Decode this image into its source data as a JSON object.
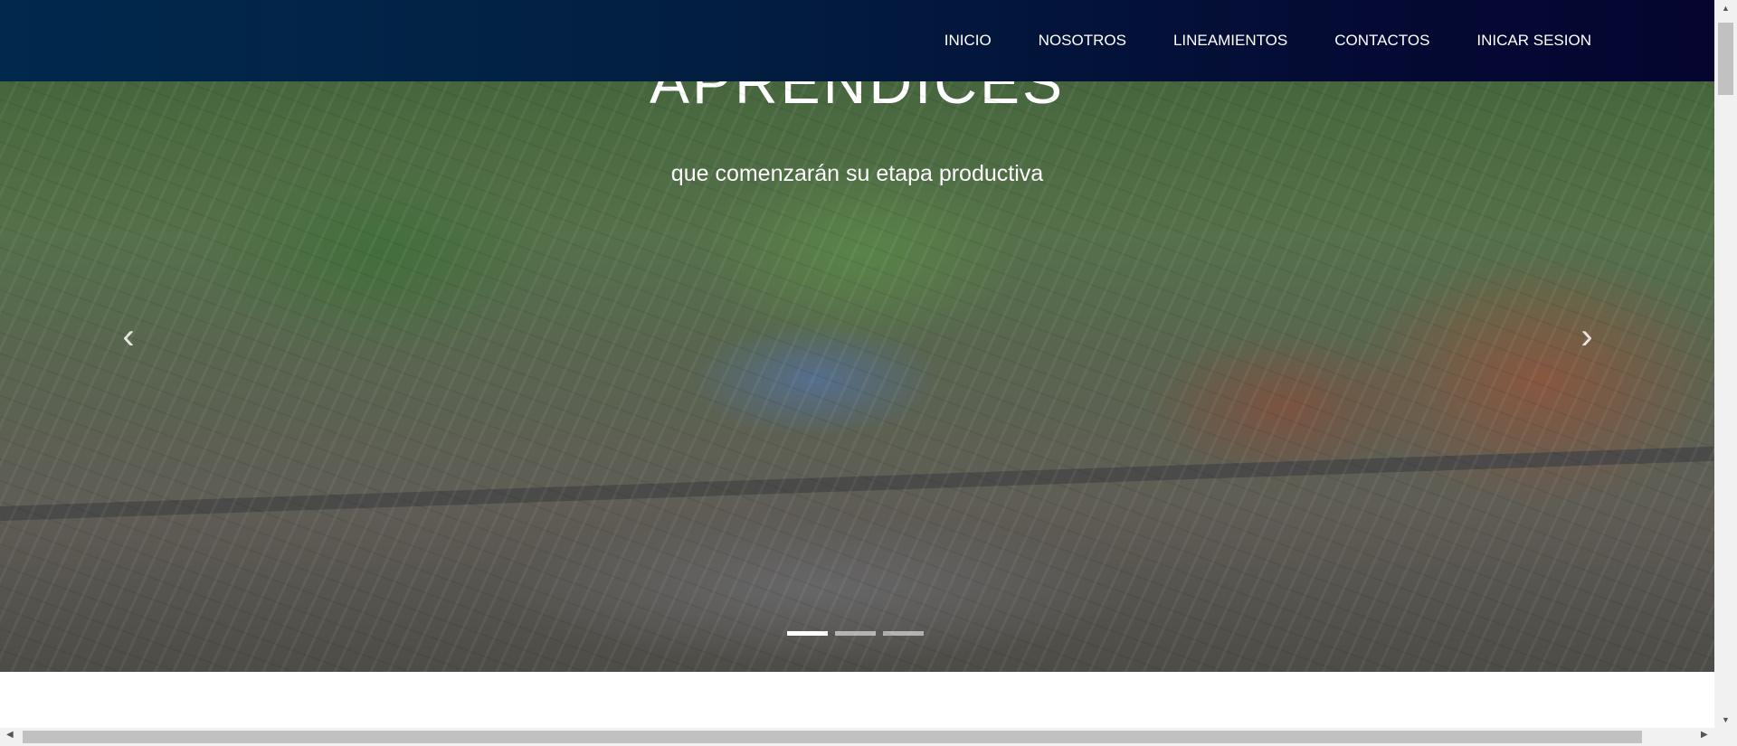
{
  "nav": {
    "items": [
      {
        "label": "INICIO"
      },
      {
        "label": "NOSOTROS"
      },
      {
        "label": "LINEAMIENTOS"
      },
      {
        "label": "CONTACTOS"
      },
      {
        "label": "INICAR SESION"
      }
    ]
  },
  "hero": {
    "title": "APRENDICES",
    "subtitle": "que comenzarán su etapa productiva",
    "prev_icon": "‹",
    "next_icon": "›",
    "slides_count": 3,
    "active_slide": 1
  },
  "scrollbars": {
    "up_icon": "▲",
    "down_icon": "▼",
    "left_icon": "◀",
    "right_icon": "▶"
  }
}
